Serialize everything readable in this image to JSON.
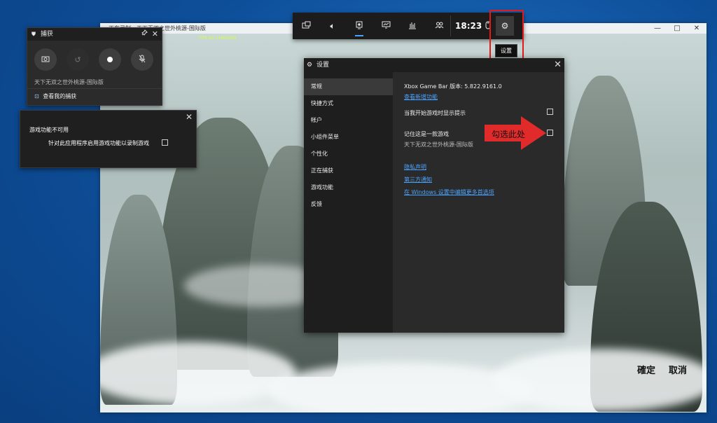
{
  "game_window": {
    "title": "正在录制 - 天下无双之世外桃源-国际版",
    "fps_text": "FPS 60 1440x900",
    "controls": {
      "minimize": "—",
      "maximize": "□",
      "close": "✕"
    },
    "confirm_label": "確定",
    "cancel_label": "取消"
  },
  "capture_panel": {
    "title": "捕获",
    "game_name": "天下无双之世外桃源-国际版",
    "see_captures_label": "查看我的捕获",
    "buttons": [
      "screenshot-icon",
      "record-last-icon",
      "record-icon",
      "mic-off-icon"
    ]
  },
  "game_features_popup": {
    "title": "游戏功能不可用",
    "checkbox_label": "针对此应用程序启用游戏功能以录制游戏",
    "checked": false
  },
  "toolbar": {
    "items": [
      "widget-menu-icon",
      "audio-icon",
      "capture-icon",
      "performance-icon",
      "resources-icon",
      "xbox-social-icon"
    ],
    "time": "18:23",
    "settings_tooltip": "设置"
  },
  "settings": {
    "title": "设置",
    "nav": [
      "常规",
      "快捷方式",
      "帐户",
      "小组件菜单",
      "个性化",
      "正在捕获",
      "游戏功能",
      "反馈"
    ],
    "selected_nav": "常规",
    "version": "Xbox Game Bar 版本: 5.822.9161.0",
    "whats_new_link": "查看新增功能",
    "show_tips_label": "当我开始游戏时显示提示",
    "show_tips_checked": false,
    "remember_game_label": "记住这是一款游戏",
    "remember_game_name": "天下无双之世外桃源-国际版",
    "remember_game_checked": false,
    "privacy_link": "隐私声明",
    "third_party_link": "第三方通知",
    "windows_settings_link": "在 Windows 设置中编辑更多首选项"
  },
  "annotation": {
    "arrow_text": "勾选此处",
    "arrow_color": "#e12a2a",
    "box_color": "#e11b1b"
  }
}
